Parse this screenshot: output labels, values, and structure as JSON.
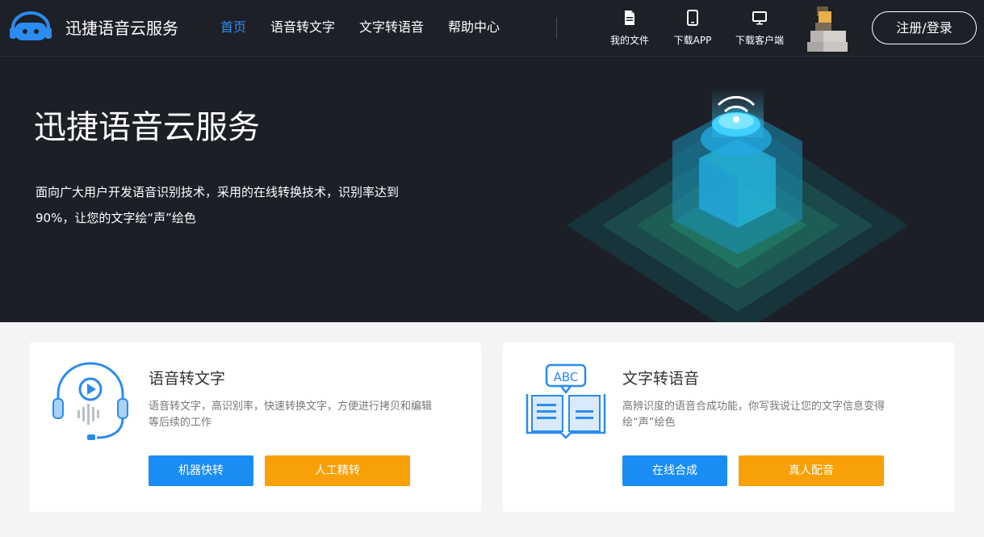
{
  "header": {
    "logo_text": "迅捷语音云服务",
    "nav": [
      "首页",
      "语音转文字",
      "文字转语音",
      "帮助中心"
    ],
    "tools": {
      "files": "我的文件",
      "app": "下载APP",
      "client": "下载客户端"
    },
    "login": "注册/登录"
  },
  "hero": {
    "title": "迅捷语音云服务",
    "desc_line1": "面向广大用户开发语音识别技术，采用的在线转换技术，识别率达到",
    "desc_line2": "90%，让您的文字绘“声”绘色"
  },
  "cards": [
    {
      "title": "语音转文字",
      "desc": "语音转文字，高识别率，快速转换文字，方便进行拷贝和编辑等后续的工作",
      "btn_primary": "机器快转",
      "btn_secondary": "人工精转"
    },
    {
      "title": "文字转语音",
      "icon_text": "ABC",
      "desc": "高辨识度的语音合成功能，你写我说让您的文字信息变得绘“声”绘色",
      "btn_primary": "在线合成",
      "btn_secondary": "真人配音"
    }
  ],
  "colors": {
    "accent": "#1a8df4",
    "orange": "#f8a007",
    "header_bg": "#1e2028"
  }
}
